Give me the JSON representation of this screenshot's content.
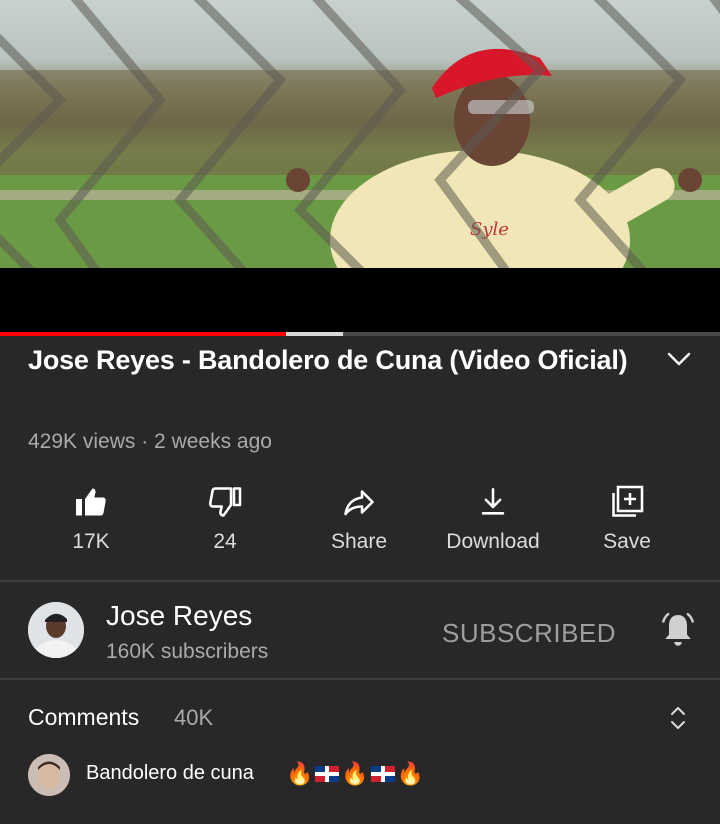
{
  "video": {
    "scene": "music-video-frame",
    "progress_played_fraction": 0.397,
    "progress_buffered_fraction": 0.476
  },
  "title": "Jose Reyes - Bandolero de Cuna (Video Oficial)",
  "meta": "429K views · 2 weeks ago",
  "actions": [
    {
      "icon": "thumbs-up-icon",
      "label": "17K"
    },
    {
      "icon": "thumbs-down-icon",
      "label": "24"
    },
    {
      "icon": "share-icon",
      "label": "Share"
    },
    {
      "icon": "download-icon",
      "label": "Download"
    },
    {
      "icon": "save-to-playlist-icon",
      "label": "Save"
    }
  ],
  "channel": {
    "name": "Jose Reyes",
    "subscribers": "160K subscribers",
    "subscribe_status": "SUBSCRIBED",
    "bell_icon": "notification-bell-icon"
  },
  "comments": {
    "title": "Comments",
    "count": "40K",
    "top_comment": {
      "text": "Bandolero de cuna",
      "emojis": [
        "fire",
        "flag-dominican-republic",
        "fire",
        "flag-dominican-republic",
        "fire"
      ]
    }
  },
  "colors": {
    "background": "#282828",
    "progress_played": "#ff0000",
    "secondary_text": "#aaaaaa"
  }
}
